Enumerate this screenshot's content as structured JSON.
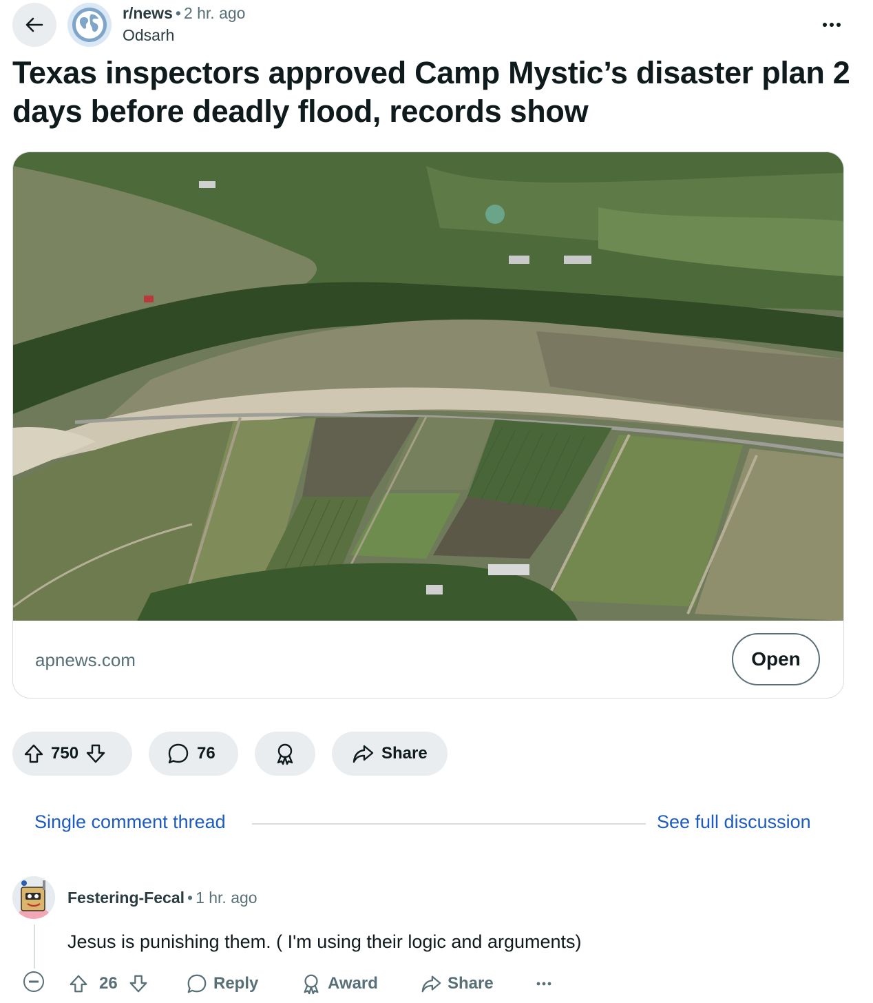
{
  "header": {
    "subreddit": "r/news",
    "separator": "•",
    "time": "2 hr. ago",
    "author": "Odsarh",
    "icons": {
      "back": "arrow-left-icon",
      "subreddit": "globe-icon",
      "more": "more-horizontal-icon"
    }
  },
  "post": {
    "title": "Texas inspectors approved Camp Mystic’s disaster plan 2 days before deadly flood, records show",
    "link_card": {
      "image": "aerial-photo-flooded-river-and-fields",
      "domain": "apnews.com",
      "open_label": "Open"
    }
  },
  "actions": {
    "votes": "750",
    "comments": "76",
    "share_label": "Share",
    "icons": {
      "upvote": "upvote-arrow-icon",
      "downvote": "downvote-arrow-icon",
      "comment": "comment-bubble-icon",
      "award": "award-icon",
      "share": "share-arrow-icon"
    }
  },
  "thread_nav": {
    "single_thread": "Single comment thread",
    "full_discussion": "See full discussion"
  },
  "comment": {
    "author": "Festering-Fecal",
    "separator": "•",
    "time": "1 hr. ago",
    "body": "Jesus is punishing them. ( I'm using their logic and arguments)",
    "votes": "26",
    "reply_label": "Reply",
    "award_label": "Award",
    "share_label": "Share",
    "icons": {
      "collapse": "collapse-minus-icon",
      "more": "more-horizontal-icon"
    }
  },
  "colors": {
    "link_blue": "#1d5bbd",
    "pill_bg": "#eaedef",
    "text_secondary": "#576f76"
  }
}
